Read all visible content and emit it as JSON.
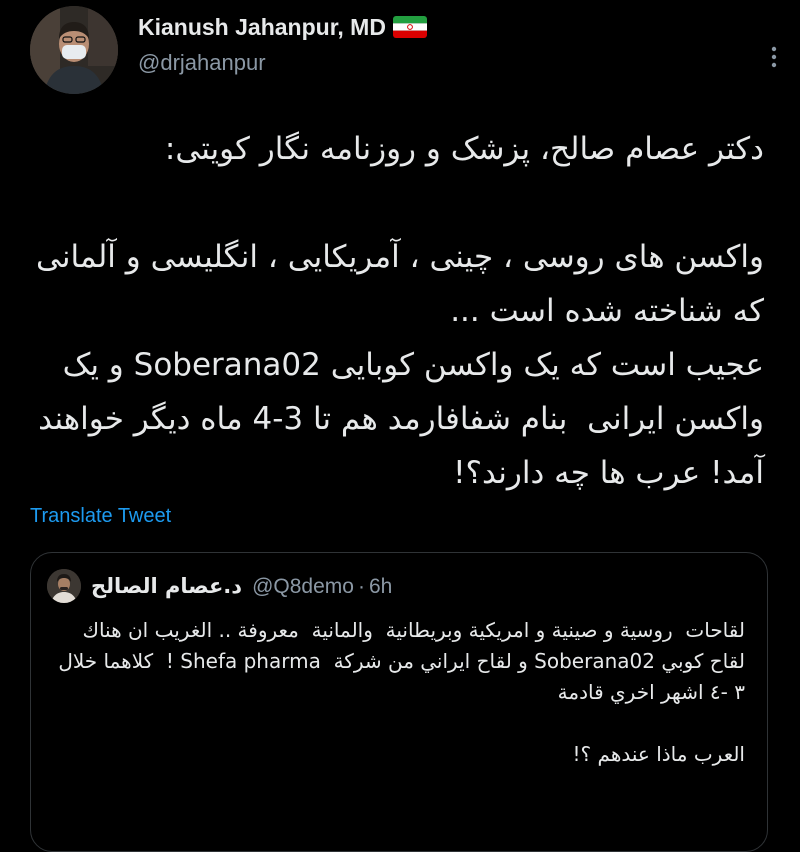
{
  "author": {
    "name": "Kianush Jahanpur, MD",
    "handle": "@drjahanpur",
    "flag_icon": "iran-flag-icon"
  },
  "tweet": {
    "text": "دکتر عصام صالح، پزشک و روزنامه نگار کویتی:\n\nواکسن های روسی ، چینی ، آمریکایی ، انگلیسی و آلمانی که شناخته شده است ...\nعجیب است که یک واکسن کوبایی Soberana02 و یک واکسن ایرانی  بنام شفافارمد هم تا 3-4 ماه دیگر خواهند آمد! عرب ها چه دارند؟!"
  },
  "translate_label": "Translate Tweet",
  "quoted_tweet": {
    "name": "د.عصام الصالح",
    "handle": "@Q8demo",
    "separator": "·",
    "time": "6h",
    "text": "لقاحات  روسية و صينية و امريكية وبريطانية  والمانية  معروفة .. الغريب ان هناك لقاح كوبي Soberana02 و لقاح ايراني من شركة  Shefa pharma !  كلاهما خلال ٣ -٤ اشهر اخري قادمة\n\nالعرب ماذا عندهم ؟!"
  },
  "colors": {
    "background": "#000000",
    "text_primary": "#e7e9ea",
    "text_secondary": "#8b98a5",
    "link": "#1d9bf0",
    "border": "#2f3336"
  },
  "icons": {
    "more": "more-options-icon"
  }
}
